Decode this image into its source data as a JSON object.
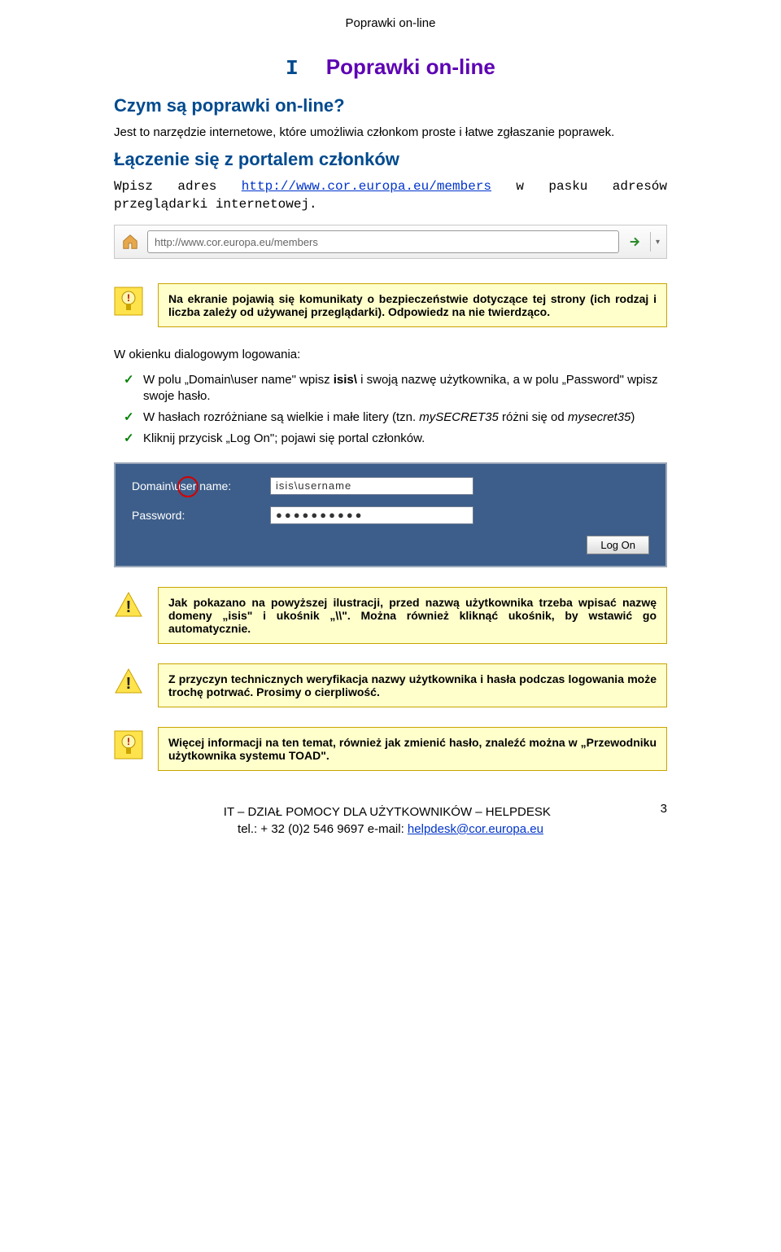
{
  "header": {
    "top": "Poprawki on-line"
  },
  "title": {
    "num": "I",
    "text": "Poprawki on-line"
  },
  "s1": {
    "heading": "Czym są poprawki on-line?",
    "p1": "Jest to narzędzie internetowe, które umożliwia członkom proste i łatwe zgłaszanie poprawek."
  },
  "s2": {
    "heading": "Łączenie się z portalem członków",
    "p1_pre": "Wpisz adres ",
    "p1_url": "http://www.cor.europa.eu/members",
    "p1_post": " w pasku adresów przeglądarki internetowej.",
    "addressbar_url": "http://www.cor.europa.eu/members"
  },
  "note1": {
    "text": "Na ekranie pojawią się komunikaty o bezpieczeństwie dotyczące tej strony (ich rodzaj i liczba zależy od używanej przeglądarki). Odpowiedz na nie twierdząco."
  },
  "dialog_intro": "W okienku dialogowym logowania:",
  "bullets": {
    "b1_pre": "W polu „Domain\\user name\" wpisz ",
    "b1_bold": "isis\\",
    "b1_mid": " i swoją nazwę użytkownika, a w polu „Password\" wpisz swoje hasło.",
    "b2_pre": "W hasłach rozróżniane są wielkie i małe litery (tzn. ",
    "b2_i1": "mySECRET35",
    "b2_mid": " różni się od ",
    "b2_i2": "mysecret35",
    "b2_post": ")",
    "b3": "Kliknij przycisk „Log On\"; pojawi się portal członków."
  },
  "login": {
    "label_user": "Domain\\user name:",
    "value_user": "isis\\username",
    "label_pass": "Password:",
    "value_pass": "●●●●●●●●●●",
    "button": "Log On"
  },
  "note2": {
    "text": "Jak pokazano na powyższej ilustracji, przed nazwą użytkownika trzeba wpisać nazwę domeny „isis\" i ukośnik „\\\\\". Można również kliknąć ukośnik, by wstawić go automatycznie."
  },
  "note3": {
    "text": "Z przyczyn technicznych weryfikacja nazwy użytkownika i hasła podczas logowania może trochę potrwać. Prosimy o cierpliwość."
  },
  "note4": {
    "text": "Więcej informacji na ten temat, również jak zmienić hasło, znaleźć można w „Przewodniku użytkownika systemu TOAD\"."
  },
  "footer": {
    "line1": "IT – DZIAŁ POMOCY DLA UŻYTKOWNIKÓW – HELPDESK",
    "line2_pre": "tel.: + 32 (0)2 546 9697  e-mail: ",
    "email": "helpdesk@cor.europa.eu",
    "page": "3"
  }
}
